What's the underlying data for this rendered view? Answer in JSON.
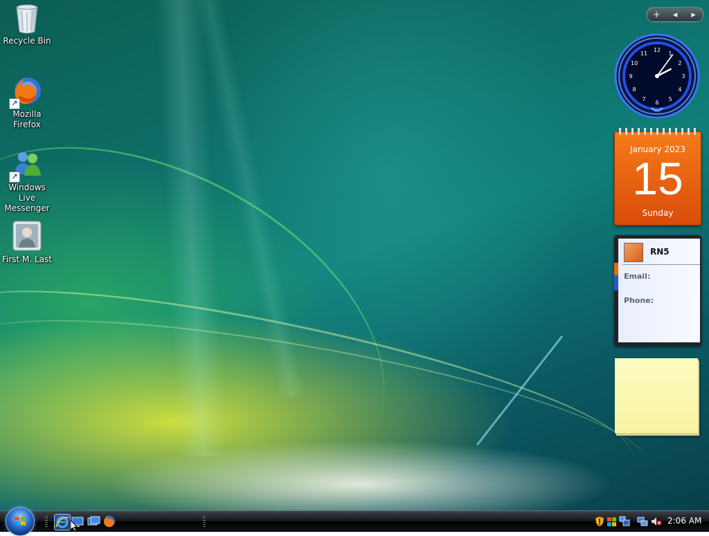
{
  "desktop_icons": [
    {
      "label": "Recycle Bin",
      "icon": "recycle-bin-icon"
    },
    {
      "label": "Mozilla Firefox",
      "icon": "firefox-icon"
    },
    {
      "label": "Windows Live Messenger",
      "icon": "messenger-icon"
    },
    {
      "label": "First M. Last",
      "icon": "user-folder-icon"
    }
  ],
  "gadget_controls": {
    "add": "+",
    "prev": "◂",
    "next": "▸"
  },
  "clock": {
    "hour": 2,
    "minute": 6,
    "numbers": [
      "12",
      "1",
      "2",
      "3",
      "4",
      "5",
      "6",
      "7",
      "8",
      "9",
      "10",
      "11"
    ]
  },
  "calendar": {
    "month_year": "January 2023",
    "day": "15",
    "weekday": "Sunday"
  },
  "contacts": {
    "name": "RN5",
    "email_label": "Email:",
    "phone_label": "Phone:"
  },
  "taskbar": {
    "quick_launch": [
      "internet-explorer-icon",
      "show-desktop-icon",
      "switch-windows-icon",
      "firefox-icon"
    ],
    "tray_icons": [
      "security-shield-icon",
      "windows-update-icon",
      "network-icon",
      "volume-muted-icon"
    ],
    "time": "2:06 AM"
  },
  "colors": {
    "calendar_orange": "#e8620f",
    "note_yellow": "#f9f5b0",
    "clock_blue": "#1e5bff"
  }
}
